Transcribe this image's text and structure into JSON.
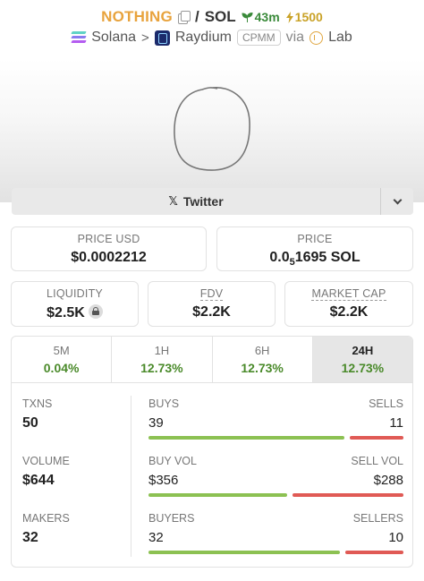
{
  "header": {
    "token": "NOTHING",
    "quote": "SOL",
    "age": "43m",
    "boost": "1500",
    "chain": "Solana",
    "dex": "Raydium",
    "pool_type": "CPMM",
    "via": "via",
    "launchpad": "Lab"
  },
  "socials": {
    "twitter_label": "Twitter"
  },
  "price": {
    "usd_label": "PRICE USD",
    "usd_value": "$0.0002212",
    "native_label": "PRICE",
    "native_prefix": "0.0",
    "native_zeros": "5",
    "native_rest": "1695 SOL"
  },
  "metrics": {
    "liquidity_label": "LIQUIDITY",
    "liquidity_value": "$2.5K",
    "fdv_label": "FDV",
    "fdv_value": "$2.2K",
    "mcap_label": "MARKET CAP",
    "mcap_value": "$2.2K"
  },
  "tabs": [
    {
      "label": "5M",
      "change": "0.04%"
    },
    {
      "label": "1H",
      "change": "12.73%"
    },
    {
      "label": "6H",
      "change": "12.73%"
    },
    {
      "label": "24H",
      "change": "12.73%"
    }
  ],
  "stats": {
    "txns": {
      "label": "TXNS",
      "value": "50",
      "left_label": "BUYS",
      "left_value": "39",
      "right_label": "SELLS",
      "right_value": "11",
      "buy_fraction": 0.78
    },
    "volume": {
      "label": "VOLUME",
      "value": "$644",
      "left_label": "BUY VOL",
      "left_value": "$356",
      "right_label": "SELL VOL",
      "right_value": "$288",
      "buy_fraction": 0.553
    },
    "makers": {
      "label": "MAKERS",
      "value": "32",
      "left_label": "BUYERS",
      "left_value": "32",
      "right_label": "SELLERS",
      "right_value": "10",
      "buy_fraction": 0.762
    }
  },
  "colors": {
    "accent_token": "#e8a33d",
    "positive": "#4a8a2a",
    "buy_bar": "#8cc152",
    "sell_bar": "#e05a55"
  }
}
